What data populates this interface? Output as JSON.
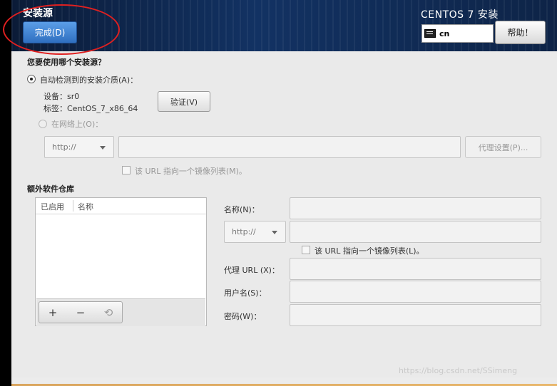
{
  "header": {
    "title": "安装源",
    "done_label": "完成(D)",
    "product": "CENTOS 7 安装",
    "keyboard": "cn",
    "help_label": "帮助！"
  },
  "source": {
    "question": "您要使用哪个安装源？",
    "auto_label": "自动检测到的安装介质(A)：",
    "device": "设备：sr0",
    "label_text": "标签：CentOS_7_x86_64",
    "verify_label": "验证(V)",
    "network_label": "在网络上(O)：",
    "protocol": "http://",
    "proxy_label": "代理设置(P)...",
    "mirror_label": "该 URL 指向一个镜像列表(M)。"
  },
  "repos": {
    "heading": "额外软件仓库",
    "col_enabled": "已启用",
    "col_name": "名称",
    "add": "+",
    "remove": "−",
    "refresh": "⟲"
  },
  "form": {
    "name_label": "名称(N)：",
    "protocol": "http://",
    "mirror_label": "该 URL 指向一个镜像列表(L)。",
    "proxy_url_label": "代理 URL (X)：",
    "username_label": "用户名(S)：",
    "password_label": "密码(W)："
  },
  "watermark": "https://blog.csdn.net/SSimeng"
}
